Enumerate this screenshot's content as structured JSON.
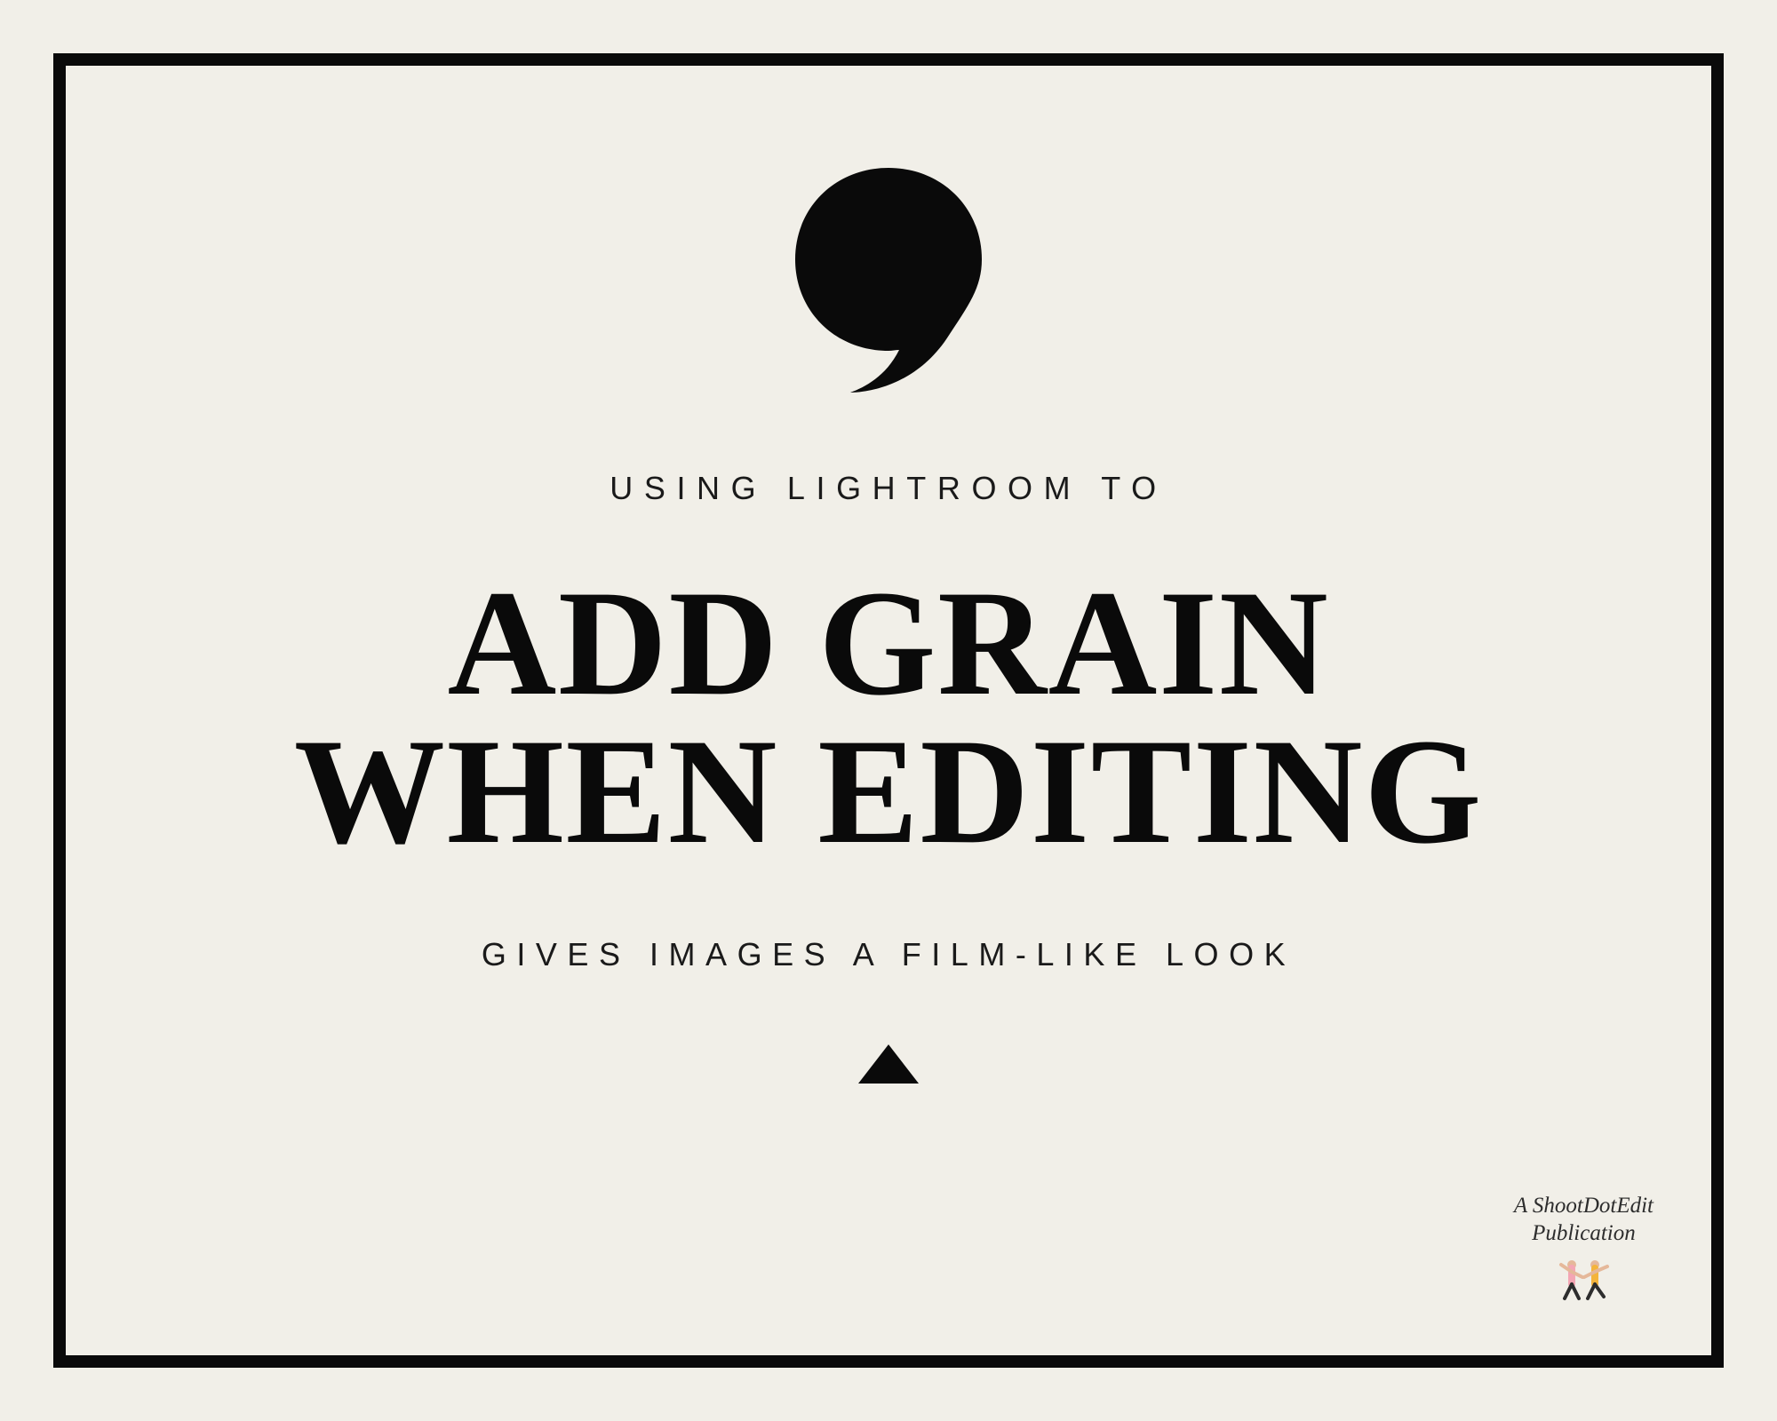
{
  "kicker": "USING LIGHTROOM TO",
  "headline_line1": "ADD GRAIN",
  "headline_line2": "WHEN EDITING",
  "tagline": "GIVES IMAGES A FILM-LIKE LOOK",
  "credit_line1": "A ShootDotEdit",
  "credit_line2": "Publication",
  "icons": {
    "quote": "quote-mark-icon",
    "triangle": "triangle-up-icon",
    "figures": "dancing-figures-icon"
  },
  "colors": {
    "background": "#f1efe8",
    "text": "#0a0a0a",
    "figure_pink": "#f4a6b4",
    "figure_yellow": "#f4b43c",
    "figure_skin": "#e5b89a"
  }
}
